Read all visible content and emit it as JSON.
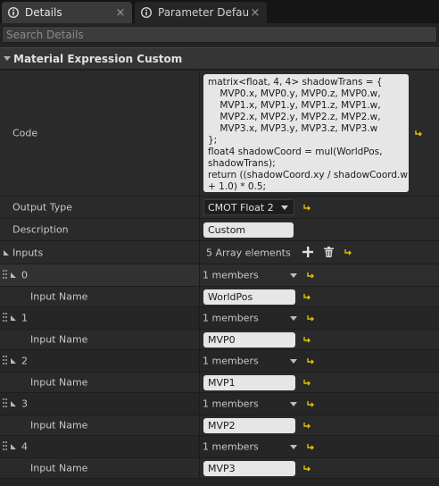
{
  "tabs": [
    {
      "label": "Details",
      "icon": "info-icon",
      "close": "×"
    },
    {
      "label": "Parameter Defaults",
      "icon": "info-icon",
      "close": "×"
    }
  ],
  "search": {
    "placeholder": "Search Details"
  },
  "category": {
    "title": "Material Expression Custom"
  },
  "code": {
    "label": "Code",
    "value": "matrix<float, 4, 4> shadowTrans = {\n    MVP0.x, MVP0.y, MVP0.z, MVP0.w,\n    MVP1.x, MVP1.y, MVP1.z, MVP1.w,\n    MVP2.x, MVP2.y, MVP2.z, MVP2.w,\n    MVP3.x, MVP3.y, MVP3.z, MVP3.w\n};\nfloat4 shadowCoord = mul(WorldPos,\nshadowTrans);\nreturn ((shadowCoord.xy / shadowCoord.w)\n+ 1.0) * 0.5;"
  },
  "output_type": {
    "label": "Output Type",
    "value": "CMOT Float 2"
  },
  "description": {
    "label": "Description",
    "value": "Custom"
  },
  "inputs": {
    "label": "Inputs",
    "summary": "5 Array elements",
    "items": [
      {
        "index": "0",
        "members": "1 members",
        "input_name_label": "Input Name",
        "input_name": "WorldPos"
      },
      {
        "index": "1",
        "members": "1 members",
        "input_name_label": "Input Name",
        "input_name": "MVP0"
      },
      {
        "index": "2",
        "members": "1 members",
        "input_name_label": "Input Name",
        "input_name": "MVP1"
      },
      {
        "index": "3",
        "members": "1 members",
        "input_name_label": "Input Name",
        "input_name": "MVP2"
      },
      {
        "index": "4",
        "members": "1 members",
        "input_name_label": "Input Name",
        "input_name": "MVP3"
      }
    ]
  },
  "colors": {
    "reset_arrow": "#e6c000",
    "panel": "#2a2a2a",
    "textbox": "#e6e6e6"
  }
}
